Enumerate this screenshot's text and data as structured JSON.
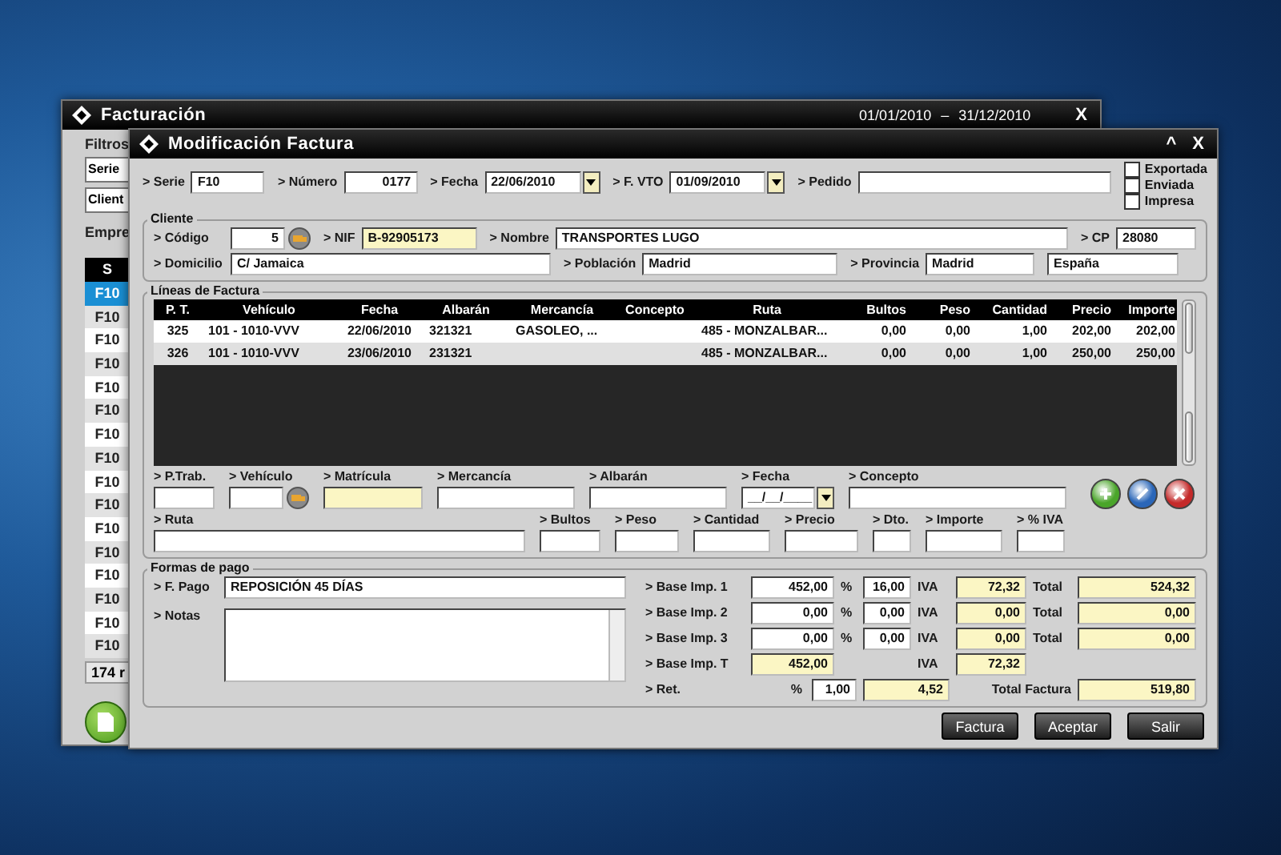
{
  "background_window": {
    "title": "Facturación",
    "date_from": "01/01/2010",
    "date_separator": "–",
    "date_to": "31/12/2010",
    "close": "X",
    "filters_label": "Filtros",
    "filter_fields": [
      "Serie",
      "Client"
    ],
    "company_label": "Empre",
    "list_header": "S",
    "list_rows": [
      {
        "value": "F10",
        "selected": true
      },
      {
        "value": "F10",
        "selected": false
      },
      {
        "value": "F10",
        "selected": false
      },
      {
        "value": "F10",
        "selected": false
      },
      {
        "value": "F10",
        "selected": false
      },
      {
        "value": "F10",
        "selected": false
      },
      {
        "value": "F10",
        "selected": false
      },
      {
        "value": "F10",
        "selected": false
      },
      {
        "value": "F10",
        "selected": false
      },
      {
        "value": "F10",
        "selected": false
      },
      {
        "value": "F10",
        "selected": false
      },
      {
        "value": "F10",
        "selected": false
      },
      {
        "value": "F10",
        "selected": false
      },
      {
        "value": "F10",
        "selected": false
      },
      {
        "value": "F10",
        "selected": false
      },
      {
        "value": "F10",
        "selected": false
      }
    ],
    "list_footer": "174 r"
  },
  "dialog": {
    "title": "Modificación  Factura",
    "minimize": "^",
    "close": "X"
  },
  "header": {
    "fields": [
      {
        "label": "> Serie",
        "value": "F10",
        "kind": "text",
        "readonly": false
      },
      {
        "label": "> Número",
        "value": "0177",
        "kind": "number",
        "readonly": false
      },
      {
        "label": "> Fecha",
        "value": "22/06/2010",
        "kind": "date",
        "readonly": false
      },
      {
        "label": "> F. VTO",
        "value": "01/09/2010",
        "kind": "date",
        "readonly": false
      },
      {
        "label": "> Pedido",
        "kind": "text",
        "readonly": false
      }
    ],
    "checks": [
      {
        "label": "Exportada",
        "checked": false
      },
      {
        "label": "Enviada",
        "checked": false
      },
      {
        "label": "Impresa",
        "checked": false
      }
    ]
  },
  "client": {
    "title": "Cliente",
    "row1": [
      {
        "label": "> Código",
        "value": "5",
        "kind": "lookup",
        "readonly": false
      },
      {
        "label": "> NIF",
        "value": "B-92905173",
        "kind": "text",
        "readonly": true
      },
      {
        "label": "> Nombre",
        "value": "TRANSPORTES LUGO",
        "kind": "text",
        "readonly": false
      },
      {
        "label": "> CP",
        "value": "28080",
        "kind": "text",
        "readonly": false
      }
    ],
    "row2": [
      {
        "label": "> Domicilio",
        "value": "C/ Jamaica",
        "readonly": false
      },
      {
        "label": "> Población",
        "value": "Madrid",
        "readonly": false
      },
      {
        "label": "> Provincia",
        "value": "Madrid",
        "readonly": false
      },
      {
        "value": "España",
        "readonly": false
      }
    ]
  },
  "lines": {
    "title": "Líneas de Factura",
    "columns": [
      "P. T.",
      "Vehículo",
      "Fecha",
      "Albarán",
      "Mercancía",
      "Concepto",
      "Ruta",
      "Bultos",
      "Peso",
      "Cantidad",
      "Precio",
      "Importe"
    ],
    "rows": [
      [
        "325",
        "101 - 1010-VVV",
        "22/06/2010",
        "321321",
        "GASOLEO, ...",
        "",
        "485 - MONZALBAR...",
        "0,00",
        "0,00",
        "1,00",
        "202,00",
        "202,00"
      ],
      [
        "326",
        "101 - 1010-VVV",
        "23/06/2010",
        "231321",
        "",
        "",
        "485 - MONZALBAR...",
        "0,00",
        "0,00",
        "1,00",
        "250,00",
        "250,00"
      ]
    ]
  },
  "line_form": {
    "row1": [
      {
        "label": "> P.Trab.",
        "kind": "text",
        "readonly": false
      },
      {
        "label": "> Vehículo",
        "kind": "lookup",
        "readonly": false
      },
      {
        "label": "> Matrícula",
        "kind": "text",
        "readonly": true
      },
      {
        "label": "> Mercancía",
        "kind": "text",
        "readonly": false
      },
      {
        "label": "> Albarán",
        "kind": "text",
        "readonly": false
      },
      {
        "label": "> Fecha",
        "value": "__/__/____",
        "kind": "date",
        "readonly": false
      },
      {
        "label": "> Concepto",
        "kind": "text",
        "readonly": false
      }
    ],
    "actions": [
      {
        "kind": "add"
      },
      {
        "kind": "edit"
      },
      {
        "kind": "delete"
      }
    ],
    "row2": [
      {
        "label": "> Ruta",
        "readonly": false
      },
      {
        "label": "> Bultos",
        "readonly": false
      },
      {
        "label": "> Peso",
        "readonly": false
      },
      {
        "label": "> Cantidad",
        "readonly": false
      },
      {
        "label": "> Precio",
        "readonly": false
      },
      {
        "label": "> Dto.",
        "readonly": false
      },
      {
        "label": "> Importe",
        "readonly": false
      },
      {
        "label": "> % IVA",
        "readonly": false
      }
    ]
  },
  "payment": {
    "title": "Formas de pago",
    "method_label": "> F. Pago",
    "method": "REPOSICIÓN 45 DÍAS",
    "notes_label": "> Notas"
  },
  "taxes": {
    "rows": [
      {
        "label": "> Base Imp. 1",
        "base": "452,00",
        "pct_label": "%",
        "rate": "16,00",
        "iva_label": "IVA",
        "iva": "72,32",
        "total_label": "Total",
        "total": "524,32"
      },
      {
        "label": "> Base Imp. 2",
        "base": "0,00",
        "pct_label": "%",
        "rate": "0,00",
        "iva_label": "IVA",
        "iva": "0,00",
        "total_label": "Total",
        "total": "0,00"
      },
      {
        "label": "> Base Imp. 3",
        "base": "0,00",
        "pct_label": "%",
        "rate": "0,00",
        "iva_label": "IVA",
        "iva": "0,00",
        "total_label": "Total",
        "total": "0,00"
      }
    ],
    "total_row": {
      "label": "> Base Imp. T",
      "base": "452,00",
      "iva_label": "IVA",
      "iva": "72,32"
    },
    "ret_row": {
      "label": "> Ret.",
      "pct_label": "%",
      "rate": "1,00",
      "amount": "4,52",
      "total_label": "Total Factura",
      "total": "519,80"
    }
  },
  "buttons": [
    "Factura",
    "Aceptar",
    "Salir"
  ]
}
